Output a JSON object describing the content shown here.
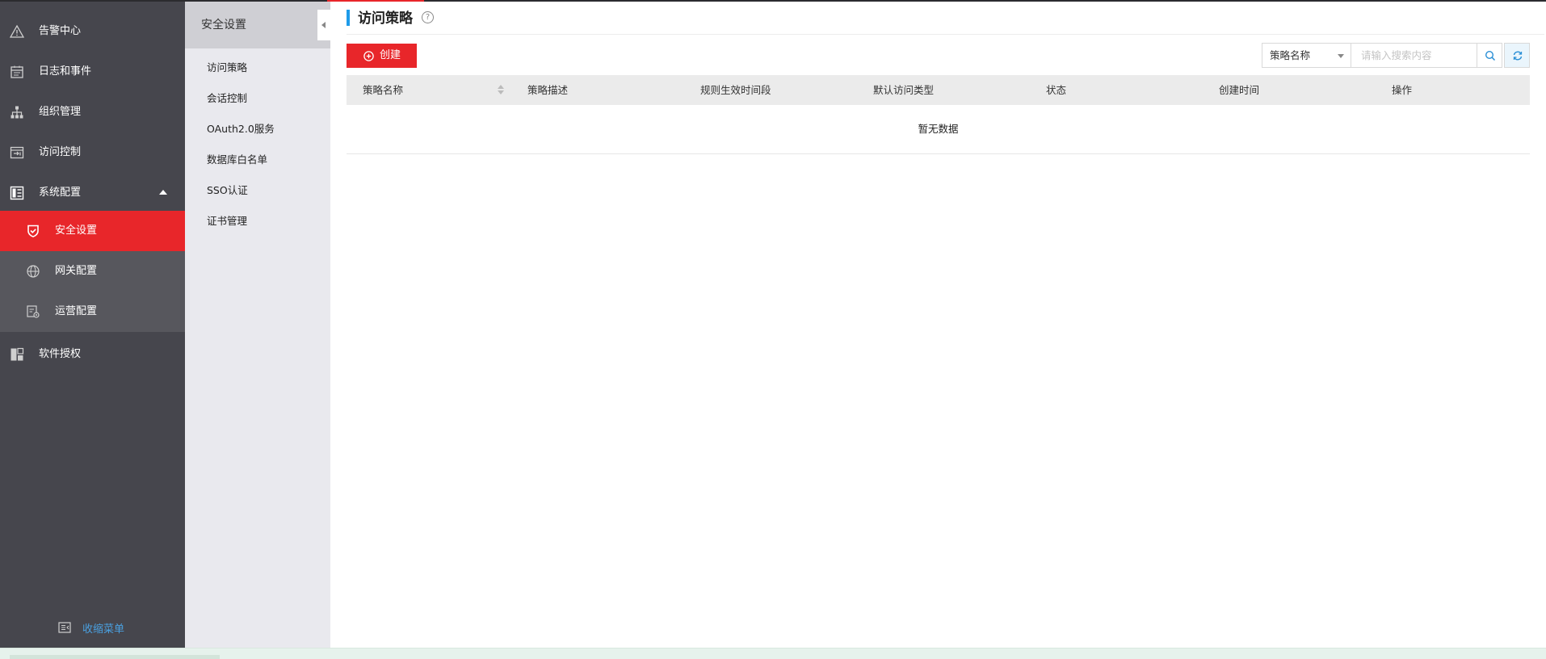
{
  "sidebar": {
    "items": [
      {
        "label": "告警中心",
        "icon": "warning-icon"
      },
      {
        "label": "日志和事件",
        "icon": "calendar-icon"
      },
      {
        "label": "组织管理",
        "icon": "org-tree-icon"
      },
      {
        "label": "访问控制",
        "icon": "access-control-icon"
      },
      {
        "label": "系统配置",
        "icon": "dashboard-icon",
        "expanded": true
      }
    ],
    "sub_items": [
      {
        "label": "安全设置",
        "icon": "shield-check-icon",
        "active": true
      },
      {
        "label": "网关配置",
        "icon": "globe-icon"
      },
      {
        "label": "运营配置",
        "icon": "operation-config-icon"
      }
    ],
    "license_item": {
      "label": "软件授权",
      "icon": "license-icon"
    },
    "collapse_label": "收缩菜单",
    "active_color": "#e8262a"
  },
  "submenu": {
    "title": "安全设置",
    "items": [
      "访问策略",
      "会话控制",
      "OAuth2.0服务",
      "数据库白名单",
      "SSO认证",
      "证书管理"
    ]
  },
  "main": {
    "title": "访问策略",
    "help_icon": "question-circle-icon",
    "create_label": "创建",
    "search": {
      "select_value": "策略名称",
      "placeholder": "请输入搜索内容"
    },
    "table": {
      "columns": [
        "策略名称",
        "策略描述",
        "规则生效时间段",
        "默认访问类型",
        "状态",
        "创建时间",
        "操作"
      ],
      "rows": [],
      "empty_text": "暂无数据"
    }
  },
  "colors": {
    "accent_red": "#e8262a",
    "title_bar_blue": "#1e9be9",
    "link_blue": "#4aa0e0",
    "sidebar_bg": "#46464d"
  }
}
